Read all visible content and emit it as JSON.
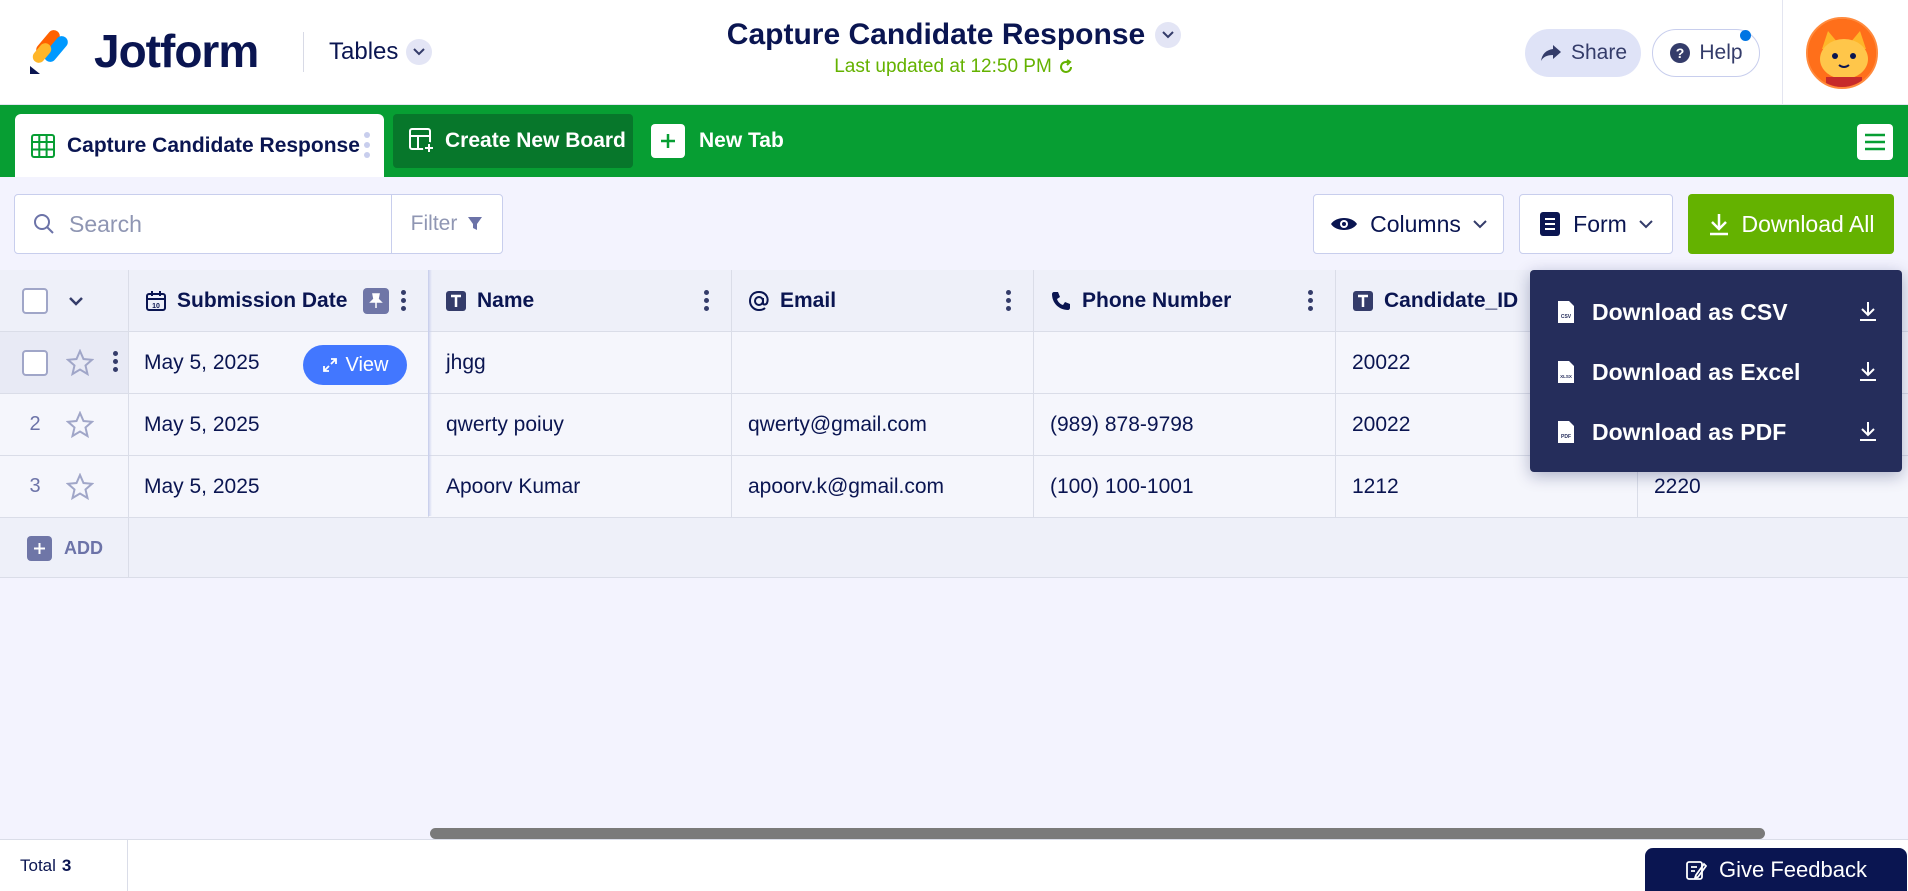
{
  "header": {
    "logo_text": "Jotform",
    "tables_label": "Tables",
    "title": "Capture Candidate Response",
    "updated": "Last updated at 12:50 PM",
    "share_label": "Share",
    "help_label": "Help"
  },
  "tabs": {
    "active_label": "Capture Candidate Response",
    "create_board_label": "Create New Board",
    "new_tab_label": "New Tab"
  },
  "toolbar": {
    "search_placeholder": "Search",
    "filter_label": "Filter",
    "columns_label": "Columns",
    "form_label": "Form",
    "download_label": "Download All"
  },
  "table": {
    "columns": [
      {
        "label": "Submission Date",
        "icon": "calendar-icon"
      },
      {
        "label": "Name",
        "icon": "text-icon"
      },
      {
        "label": "Email",
        "icon": "at-icon"
      },
      {
        "label": "Phone Number",
        "icon": "phone-icon"
      },
      {
        "label": "Candidate_ID",
        "icon": "text-icon"
      }
    ],
    "view_label": "View",
    "rows": [
      {
        "num": "",
        "date": "May 5, 2025",
        "name": "jhgg",
        "email": "",
        "phone": "",
        "candidate_id": "20022",
        "extra": ""
      },
      {
        "num": "2",
        "date": "May 5, 2025",
        "name": "qwerty poiuy",
        "email": "qwerty@gmail.com",
        "phone": "(989) 878-9798",
        "candidate_id": "20022",
        "extra": ""
      },
      {
        "num": "3",
        "date": "May 5, 2025",
        "name": "Apoorv Kumar",
        "email": "apoorv.k@gmail.com",
        "phone": "(100) 100-1001",
        "candidate_id": "1212",
        "extra": "2220"
      }
    ],
    "add_label": "ADD"
  },
  "footer": {
    "total_label": "Total",
    "total_value": "3",
    "feedback_label": "Give Feedback"
  },
  "download_menu": {
    "items": [
      {
        "label": "Download as CSV",
        "badge": "CSV"
      },
      {
        "label": "Download as Excel",
        "badge": "XLSX"
      },
      {
        "label": "Download as PDF",
        "badge": "PDF"
      }
    ]
  },
  "colors": {
    "brand_green": "#079e33",
    "download_green": "#64b200",
    "navy": "#0a1551",
    "view_blue": "#4277ff",
    "menu_bg": "#252d5b"
  }
}
